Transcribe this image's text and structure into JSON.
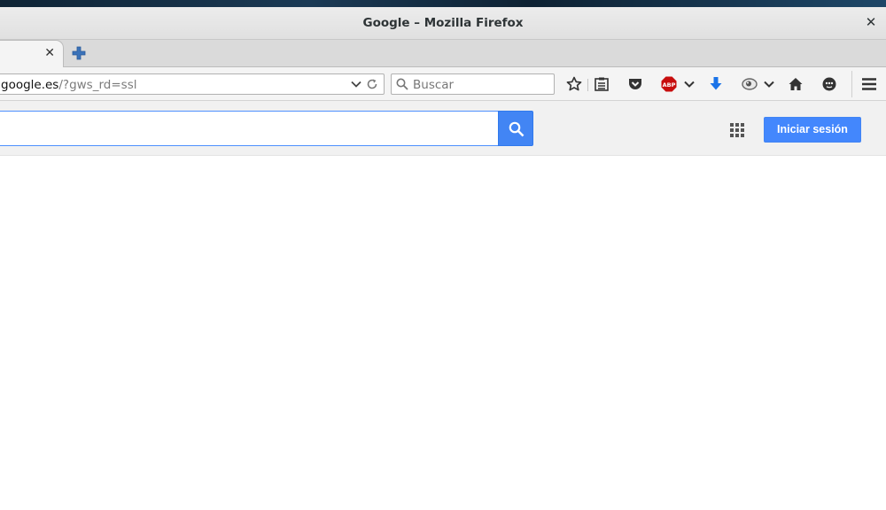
{
  "window": {
    "title": "Google – Mozilla Firefox"
  },
  "navbar": {
    "url_host": "google.es",
    "url_path": "/?gws_rd=ssl",
    "search_placeholder": "Buscar",
    "icons": [
      "bookmark-star-icon",
      "reading-list-icon",
      "pocket-icon",
      "adblock-plus-icon",
      "chevron-down-icon",
      "download-icon",
      "privacy-icon",
      "chevron-down-icon",
      "home-icon",
      "chat-icon",
      "hamburger-menu-icon"
    ]
  },
  "google": {
    "signin_label": "Iniciar sesión",
    "search_value": ""
  },
  "colors": {
    "google_blue": "#4285f4",
    "signin_blue": "#4387fd",
    "abp_red": "#c70d0d",
    "download_blue": "#1a73e8"
  }
}
